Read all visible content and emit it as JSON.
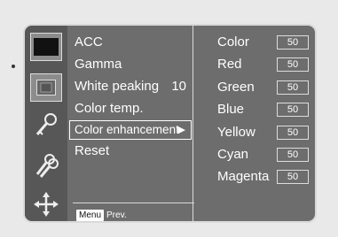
{
  "menu": {
    "items": [
      {
        "label": "ACC",
        "value": ""
      },
      {
        "label": "Gamma",
        "value": ""
      },
      {
        "label": "White peaking",
        "value": "10"
      },
      {
        "label": "Color temp.",
        "value": ""
      },
      {
        "label": "Color enhancement",
        "value": "",
        "arrow": "▶",
        "selected": true
      },
      {
        "label": "Reset",
        "value": ""
      }
    ]
  },
  "footer": {
    "key_label": "Menu",
    "hint": "Prev."
  },
  "color_values": [
    {
      "label": "Color",
      "value": "50"
    },
    {
      "label": "Red",
      "value": "50"
    },
    {
      "label": "Green",
      "value": "50"
    },
    {
      "label": "Blue",
      "value": "50"
    },
    {
      "label": "Yellow",
      "value": "50"
    },
    {
      "label": "Cyan",
      "value": "50"
    },
    {
      "label": "Magenta",
      "value": "50"
    }
  ],
  "icons": [
    "picture-icon",
    "screen-icon",
    "key-icon",
    "keys-icon",
    "move-arrows-icon"
  ]
}
